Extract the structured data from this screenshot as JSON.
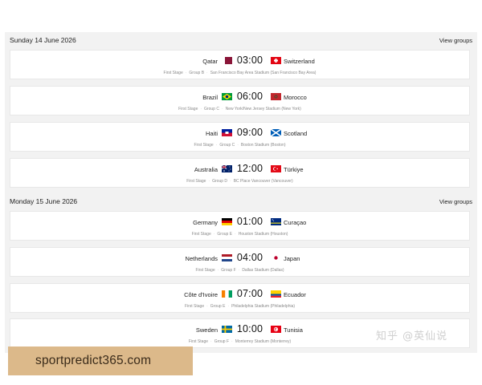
{
  "days": [
    {
      "date": "Sunday 14 June 2026",
      "view_label": "View groups",
      "matches": [
        {
          "home": "Qatar",
          "home_flag": "qatar-flag",
          "time": "03:00",
          "away": "Switzerland",
          "away_flag": "switzerland-flag",
          "stage": "First Stage",
          "group": "Group B",
          "venue": "San Francisco Bay Area Stadium (San Francisco Bay Area)"
        },
        {
          "home": "Brazil",
          "home_flag": "brazil-flag",
          "time": "06:00",
          "away": "Morocco",
          "away_flag": "morocco-flag",
          "stage": "First Stage",
          "group": "Group C",
          "venue": "New York/New Jersey Stadium (New York)"
        },
        {
          "home": "Haiti",
          "home_flag": "haiti-flag",
          "time": "09:00",
          "away": "Scotland",
          "away_flag": "scotland-flag",
          "stage": "First Stage",
          "group": "Group C",
          "venue": "Boston Stadium (Boston)"
        },
        {
          "home": "Australia",
          "home_flag": "australia-flag",
          "time": "12:00",
          "away": "Türkiye",
          "away_flag": "turkiye-flag",
          "stage": "First Stage",
          "group": "Group D",
          "venue": "BC Place Vancouver (Vancouver)"
        }
      ]
    },
    {
      "date": "Monday 15 June 2026",
      "view_label": "View groups",
      "matches": [
        {
          "home": "Germany",
          "home_flag": "germany-flag",
          "time": "01:00",
          "away": "Curaçao",
          "away_flag": "curacao-flag",
          "stage": "First Stage",
          "group": "Group E",
          "venue": "Houston Stadium (Houston)"
        },
        {
          "home": "Netherlands",
          "home_flag": "netherlands-flag",
          "time": "04:00",
          "away": "Japan",
          "away_flag": "japan-flag",
          "stage": "First Stage",
          "group": "Group F",
          "venue": "Dallas Stadium (Dallas)"
        },
        {
          "home": "Côte d'Ivoire",
          "home_flag": "cote-divoire-flag",
          "time": "07:00",
          "away": "Ecuador",
          "away_flag": "ecuador-flag",
          "stage": "First Stage",
          "group": "Group E",
          "venue": "Philadelphia Stadium (Philadelphia)"
        },
        {
          "home": "Sweden",
          "home_flag": "sweden-flag",
          "time": "10:00",
          "away": "Tunisia",
          "away_flag": "tunisia-flag",
          "stage": "First Stage",
          "group": "Group F",
          "venue": "Monterrey Stadium (Monterrey)"
        }
      ]
    }
  ],
  "watermark": "知乎 @英仙说",
  "promo": "sportpredict365.com",
  "colors": {
    "panel": "#f2f2f2",
    "card": "#ffffff",
    "meta": "#8a8a8a",
    "promo_bg": "#dcb98a"
  }
}
